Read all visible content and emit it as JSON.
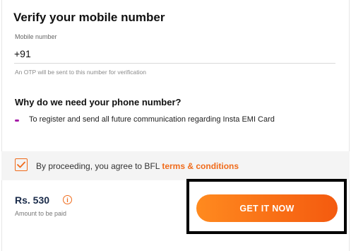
{
  "verify": {
    "title": "Verify your mobile number",
    "field_label": "Mobile number",
    "country_code": "+91",
    "phone_value": "",
    "hint": "An OTP will be sent to this number for verification"
  },
  "why": {
    "title": "Why do we need your phone number?",
    "reasons": [
      "To register and send all future communication regarding Insta EMI Card"
    ]
  },
  "consent": {
    "checked": true,
    "text": "By proceeding, you agree to BFL ",
    "link_label": "terms & conditions"
  },
  "payment": {
    "amount": "Rs. 530",
    "info_icon": "info-icon",
    "amount_label": "Amount to be paid"
  },
  "cta": {
    "label": "GET IT NOW"
  },
  "colors": {
    "accent": "#f06b1b",
    "bullet": "#a61ca8",
    "price_text": "#1a2b4a"
  }
}
